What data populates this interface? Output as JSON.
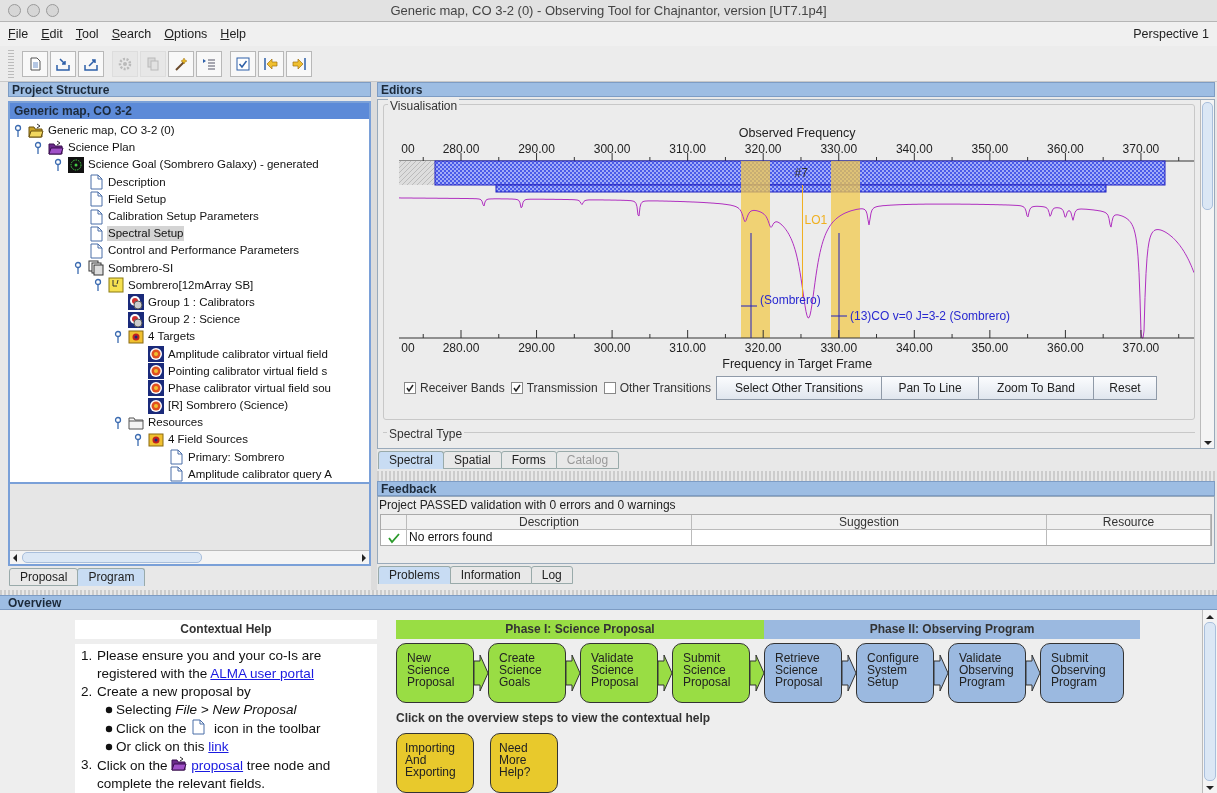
{
  "window": {
    "title": "Generic map, CO 3-2 (0) - Observing Tool for Chajnantor, version [UT7.1p4]"
  },
  "menu": [
    "File",
    "Edit",
    "Tool",
    "Search",
    "Options",
    "Help"
  ],
  "perspective": "Perspective 1",
  "toolbar": [
    [
      {
        "kind": "new",
        "disabled": false
      },
      {
        "kind": "import",
        "disabled": false
      },
      {
        "kind": "export",
        "disabled": false
      }
    ],
    [
      {
        "kind": "gear",
        "disabled": true
      },
      {
        "kind": "copy",
        "disabled": true
      },
      {
        "kind": "wand",
        "disabled": false
      },
      {
        "kind": "indent",
        "disabled": false
      }
    ],
    [
      {
        "kind": "validate",
        "disabled": false
      },
      {
        "kind": "prev",
        "disabled": false
      },
      {
        "kind": "next",
        "disabled": false
      }
    ]
  ],
  "project_structure": {
    "title": "Project Structure",
    "tree_title": "Generic map, CO 3-2",
    "tree": [
      {
        "label": "Generic map, CO 3-2 (0)",
        "kind": "folder-open",
        "expanded": true,
        "selected": false,
        "children": [
          {
            "label": "Science Plan",
            "kind": "folder-purple",
            "expanded": true,
            "selected": false,
            "children": [
              {
                "label": "Science Goal (Sombrero Galaxy) - generated",
                "kind": "goal",
                "expanded": true,
                "selected": false,
                "children": [
                  {
                    "label": "Description",
                    "kind": "document",
                    "selected": false
                  },
                  {
                    "label": "Field Setup",
                    "kind": "document",
                    "selected": false
                  },
                  {
                    "label": "Calibration Setup Parameters",
                    "kind": "document",
                    "selected": false
                  },
                  {
                    "label": "Spectral Setup",
                    "kind": "document",
                    "selected": true
                  },
                  {
                    "label": "Control and Performance Parameters",
                    "kind": "document",
                    "selected": false
                  },
                  {
                    "label": "Sombrero-SI",
                    "kind": "stack",
                    "expanded": true,
                    "selected": false,
                    "children": [
                      {
                        "label": "Sombrero[12mArray SB]",
                        "kind": "block",
                        "expanded": true,
                        "selected": false,
                        "children": [
                          {
                            "label": "Group 1 : Calibrators",
                            "kind": "group",
                            "selected": false
                          },
                          {
                            "label": "Group 2 : Science",
                            "kind": "group",
                            "selected": false
                          },
                          {
                            "label": "4 Targets",
                            "kind": "targets",
                            "expanded": true,
                            "selected": false,
                            "children": [
                              {
                                "label": "Amplitude calibrator virtual field",
                                "kind": "target",
                                "selected": false
                              },
                              {
                                "label": "Pointing calibrator virtual field s",
                                "kind": "target",
                                "selected": false
                              },
                              {
                                "label": "Phase calibrator virtual field sou",
                                "kind": "target",
                                "selected": false
                              },
                              {
                                "label": "[R] Sombrero (Science)",
                                "kind": "target",
                                "selected": false
                              }
                            ]
                          },
                          {
                            "label": "Resources",
                            "kind": "folder",
                            "expanded": true,
                            "selected": false,
                            "children": [
                              {
                                "label": "4 Field Sources",
                                "kind": "targets",
                                "expanded": true,
                                "selected": false,
                                "children": [
                                  {
                                    "label": "Primary: Sombrero",
                                    "kind": "document",
                                    "selected": false
                                  },
                                  {
                                    "label": "Amplitude calibrator query A",
                                    "kind": "document",
                                    "selected": false
                                  }
                                ]
                              }
                            ]
                          }
                        ]
                      }
                    ]
                  }
                ]
              }
            ]
          }
        ]
      }
    ],
    "tabs": [
      {
        "label": "Proposal",
        "selected": false
      },
      {
        "label": "Program",
        "selected": true
      }
    ]
  },
  "editors": {
    "title": "Editors",
    "group_title": "Visualisation",
    "visualisation": {
      "title": "Observed Frequency",
      "top_ticks": [
        "00",
        "280.00",
        "290.00",
        "300.00",
        "310.00",
        "320.00",
        "330.00",
        "340.00",
        "350.00",
        "360.00",
        "370.00"
      ],
      "bottom_ticks": [
        "00",
        "280.00",
        "290.00",
        "300.00",
        "310.00",
        "320.00",
        "330.00",
        "340.00",
        "350.00",
        "360.00",
        "370.00"
      ],
      "band_label": "#7",
      "lo_label": "LO1",
      "line_labels": [
        "(Sombrero)",
        "(13)CO v=0 J=3-2 (Sombrero)"
      ],
      "xlabel": "Frequency in Target Frame"
    },
    "checkboxes": [
      {
        "label": "Receiver Bands",
        "checked": true
      },
      {
        "label": "Transmission",
        "checked": true
      },
      {
        "label": "Other Transitions",
        "checked": false
      }
    ],
    "buttons": [
      "Select Other Transitions",
      "Pan To Line",
      "Zoom To Band",
      "Reset"
    ],
    "next_section": "Spectral Type",
    "tabs": [
      {
        "label": "Spectral",
        "selected": true,
        "disabled": false
      },
      {
        "label": "Spatial",
        "selected": false,
        "disabled": false
      },
      {
        "label": "Forms",
        "selected": false,
        "disabled": false
      },
      {
        "label": "Catalog",
        "selected": false,
        "disabled": true
      }
    ]
  },
  "feedback": {
    "title": "Feedback",
    "message": "Project PASSED validation with 0 errors and 0 warnings",
    "columns": [
      "Description",
      "Suggestion",
      "Resource"
    ],
    "rows": [
      {
        "kind": "ok",
        "cells": [
          "No errors found"
        ]
      }
    ],
    "tabs": [
      {
        "label": "Problems",
        "selected": true
      },
      {
        "label": "Information",
        "selected": false
      },
      {
        "label": "Log",
        "selected": false
      }
    ]
  },
  "overview": {
    "title": "Overview",
    "help_title": "Contextual Help",
    "help": [
      {
        "number": "1.",
        "parts": [
          {
            "kind": "text",
            "text": "Please ensure you and your co-Is are registered with the "
          },
          {
            "kind": "link",
            "text": "ALMA user portal"
          }
        ]
      },
      {
        "number": "2.",
        "parts": [
          {
            "kind": "text",
            "text": "Create a new proposal by"
          }
        ],
        "bullets": [
          [
            {
              "kind": "text",
              "text": "Selecting *File > New Proposal*"
            }
          ],
          [
            {
              "kind": "text",
              "text": "Click on the "
            },
            {
              "kind": "doc"
            },
            {
              "kind": "text",
              "text": " icon in the toolbar"
            }
          ],
          [
            {
              "kind": "text",
              "text": "Or click on this "
            },
            {
              "kind": "link",
              "text": "link"
            }
          ]
        ]
      },
      {
        "number": "3.",
        "parts": [
          {
            "kind": "text",
            "text": "Click on the "
          },
          {
            "kind": "folder"
          },
          {
            "kind": "link",
            "text": "proposal"
          },
          {
            "kind": "text",
            "text": " tree node and complete the relevant fields."
          }
        ]
      }
    ],
    "phases": [
      {
        "title": "Phase I: Science Proposal",
        "color": "#99dd44",
        "steps": [
          "New Science Proposal",
          "Create Science Goals",
          "Validate Science Proposal",
          "Submit Science Proposal"
        ]
      },
      {
        "title": "Phase II: Observing Program",
        "color": "#9bb9e0",
        "steps": [
          "Retrieve Science Proposal",
          "Configure System Setup",
          "Validate Observing Program",
          "Submit Observing Program"
        ]
      }
    ],
    "caption": "Click on the overview steps to view the contextual help",
    "extras": [
      {
        "label": "Importing And Exporting",
        "color": "#e8c92c"
      },
      {
        "label": "Need More Help?",
        "color": "#e8c92c"
      }
    ]
  }
}
